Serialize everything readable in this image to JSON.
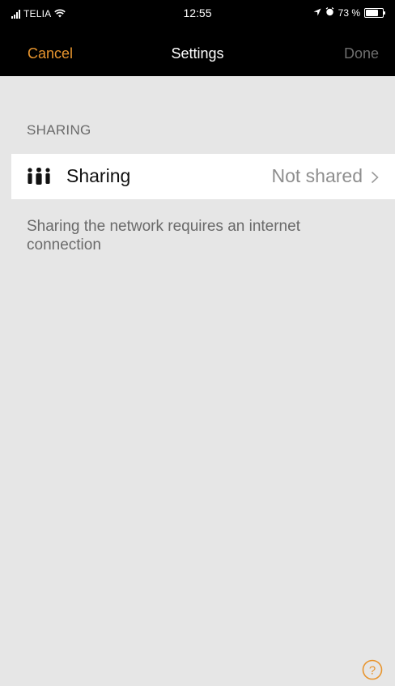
{
  "status_bar": {
    "carrier": "TELIA",
    "time": "12:55",
    "battery": "73 %",
    "battery_level": 0.73,
    "icons": [
      "signal-icon",
      "wifi-icon",
      "location-icon",
      "alarm-icon",
      "battery-icon"
    ]
  },
  "nav": {
    "cancel_label": "Cancel",
    "title": "Settings",
    "done_label": "Done"
  },
  "section": {
    "header": "SHARING",
    "row": {
      "icon": "people-icon",
      "label": "Sharing",
      "value": "Not shared"
    },
    "footer": "Sharing the network requires an internet connection"
  },
  "help": {
    "icon": "help-icon"
  },
  "colors": {
    "accent": "#e8952e",
    "background": "#e6e6e6",
    "bar": "#000000",
    "secondary_text": "#6a6a6a"
  }
}
